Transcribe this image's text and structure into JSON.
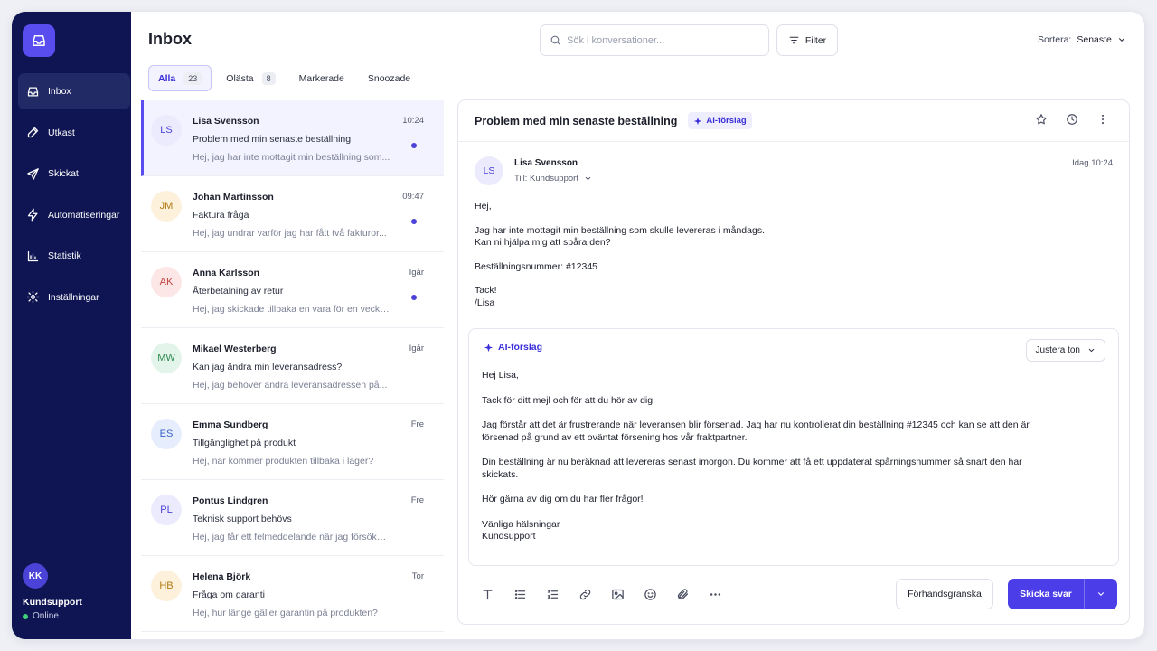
{
  "sidebar": {
    "logo_icon": "inbox-tray-icon",
    "items": [
      {
        "label": "Inbox",
        "icon": "inbox-icon",
        "active": true
      },
      {
        "label": "Utkast",
        "icon": "pencil-icon",
        "active": false
      },
      {
        "label": "Skickat",
        "icon": "send-icon",
        "active": false
      },
      {
        "label": "Automatiseringar",
        "icon": "lightning-icon",
        "active": false
      },
      {
        "label": "Statistik",
        "icon": "bar-chart-icon",
        "active": false
      },
      {
        "label": "Inställningar",
        "icon": "gear-icon",
        "active": false
      }
    ],
    "user": {
      "initials": "KK",
      "name": "Kundsupport",
      "status": "Online"
    }
  },
  "header": {
    "title": "Inbox",
    "search_placeholder": "Sök i konversationer...",
    "filter_label": "Filter",
    "sort_label": "Sortera:",
    "sort_value": "Senaste"
  },
  "tabs": [
    {
      "label": "Alla",
      "count": "23",
      "active": true
    },
    {
      "label": "Olästa",
      "count": "8",
      "active": false
    },
    {
      "label": "Markerade",
      "count": "",
      "active": false
    },
    {
      "label": "Snoozade",
      "count": "",
      "active": false
    }
  ],
  "conversations": [
    {
      "initials": "LS",
      "name": "Lisa Svensson",
      "subject": "Problem med min senaste beställning",
      "preview": "Hej, jag har inte mottagit min beställning som...",
      "time": "10:24",
      "unread": true,
      "active": true,
      "avatar_bg": "#ecebfd",
      "avatar_fg": "#4b43d8"
    },
    {
      "initials": "JM",
      "name": "Johan Martinsson",
      "subject": "Faktura fråga",
      "preview": "Hej, jag undrar varför jag har fått två fakturor...",
      "time": "09:47",
      "unread": true,
      "active": false,
      "avatar_bg": "#fdf1dc",
      "avatar_fg": "#b07a12"
    },
    {
      "initials": "AK",
      "name": "Anna Karlsson",
      "subject": "Återbetalning av retur",
      "preview": "Hej, jag skickade tillbaka en vara för en vecka...",
      "time": "Igår",
      "unread": true,
      "active": false,
      "avatar_bg": "#fde6e6",
      "avatar_fg": "#c0443f"
    },
    {
      "initials": "MW",
      "name": "Mikael Westerberg",
      "subject": "Kan jag ändra min leveransadress?",
      "preview": "Hej, jag behöver ändra leveransadressen på...",
      "time": "Igår",
      "unread": false,
      "active": false,
      "avatar_bg": "#e3f5ea",
      "avatar_fg": "#2f8a52"
    },
    {
      "initials": "ES",
      "name": "Emma Sundberg",
      "subject": "Tillgänglighet på produkt",
      "preview": "Hej, när kommer produkten tillbaka i lager?",
      "time": "Fre",
      "unread": false,
      "active": false,
      "avatar_bg": "#e6eefd",
      "avatar_fg": "#3a62c4"
    },
    {
      "initials": "PL",
      "name": "Pontus Lindgren",
      "subject": "Teknisk support behövs",
      "preview": "Hej, jag får ett felmeddelande när jag försöker...",
      "time": "Fre",
      "unread": false,
      "active": false,
      "avatar_bg": "#ecebfd",
      "avatar_fg": "#4b43d8"
    },
    {
      "initials": "HB",
      "name": "Helena Björk",
      "subject": "Fråga om garanti",
      "preview": "Hej, hur länge gäller garantin på produkten?",
      "time": "Tor",
      "unread": false,
      "active": false,
      "avatar_bg": "#fdf1dc",
      "avatar_fg": "#b07a12"
    }
  ],
  "detail": {
    "subject": "Problem med min senaste beställning",
    "ai_badge": "AI-förslag",
    "action_icons": [
      "star-icon",
      "clock-icon",
      "more-vertical-icon"
    ],
    "sender_initials": "LS",
    "sender_name": "Lisa Svensson",
    "recipient": "Till: Kundsupport",
    "date": "Idag 10:24",
    "message": [
      "Hej,",
      "Jag har inte mottagit min beställning som skulle levereras i måndags.\nKan ni hjälpa mig att spåra den?",
      "Beställningsnummer: #12345",
      "Tack!\n/Lisa"
    ]
  },
  "ai_suggestion": {
    "label": "AI-förslag",
    "tone_label": "Justera ton",
    "reply": [
      "Hej Lisa,",
      "Tack för ditt mejl och för att du hör av dig.",
      "Jag förstår att det är frustrerande när leveransen blir försenad. Jag har nu kontrollerat din beställning #12345 och kan se att den är försenad på grund av ett oväntat försening hos vår fraktpartner.",
      "Din beställning är nu beräknad att levereras senast imorgon. Du kommer att få ett uppdaterat spårningsnummer så snart den har skickats.",
      "Hör gärna av dig om du har fler frågor!",
      "Vänliga hälsningar\nKundsupport"
    ]
  },
  "composer": {
    "tools": [
      "text-format-icon",
      "bullet-list-icon",
      "numbered-list-icon",
      "link-icon",
      "image-icon",
      "emoji-icon",
      "attachment-icon",
      "more-horizontal-icon"
    ],
    "preview_label": "Förhandsgranska",
    "send_label": "Skicka svar"
  },
  "colors": {
    "sidebar": "#0f1552",
    "accent": "#4b3de8",
    "unread_dot": "#4b43d8",
    "online": "#3fcf7a"
  }
}
